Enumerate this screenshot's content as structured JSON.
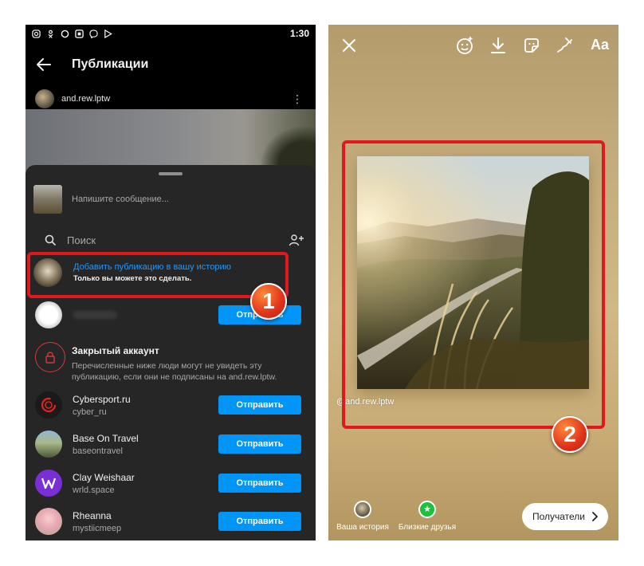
{
  "left": {
    "status_bar": {
      "time": "1:30"
    },
    "header": {
      "title": "Публикации"
    },
    "post": {
      "author": "and.rew.lptw"
    },
    "share_sheet": {
      "message_placeholder": "Напишите сообщение...",
      "search_label": "Поиск",
      "add_to_story": {
        "title": "Добавить публикацию в вашу историю",
        "subtitle": "Только вы можете это сделать."
      },
      "send_label": "Отправить",
      "private_account": {
        "title": "Закрытый аккаунт",
        "description": "Перечисленные ниже люди могут не увидеть эту публикацию, если они не подписаны на and.rew.lptw."
      },
      "contacts": [
        {
          "name": "Cybersport.ru",
          "username": "cyber_ru"
        },
        {
          "name": "Base On Travel",
          "username": "baseontravel"
        },
        {
          "name": "Clay Weishaar",
          "username": "wrld.space"
        },
        {
          "name": "Rheanna",
          "username": "mystiicmeep"
        }
      ]
    }
  },
  "right": {
    "toolbar": {
      "text_tool": "Aa"
    },
    "story": {
      "username": "@and.rew.lptw"
    },
    "bottom": {
      "your_story": "Ваша история",
      "close_friends": "Близкие друзья",
      "recipients": "Получатели"
    }
  },
  "annotations": {
    "step1": "1",
    "step2": "2"
  },
  "colors": {
    "accent_blue": "#0095f6",
    "highlight_red": "#e0191e",
    "close_friends_green": "#1dbf3c"
  }
}
